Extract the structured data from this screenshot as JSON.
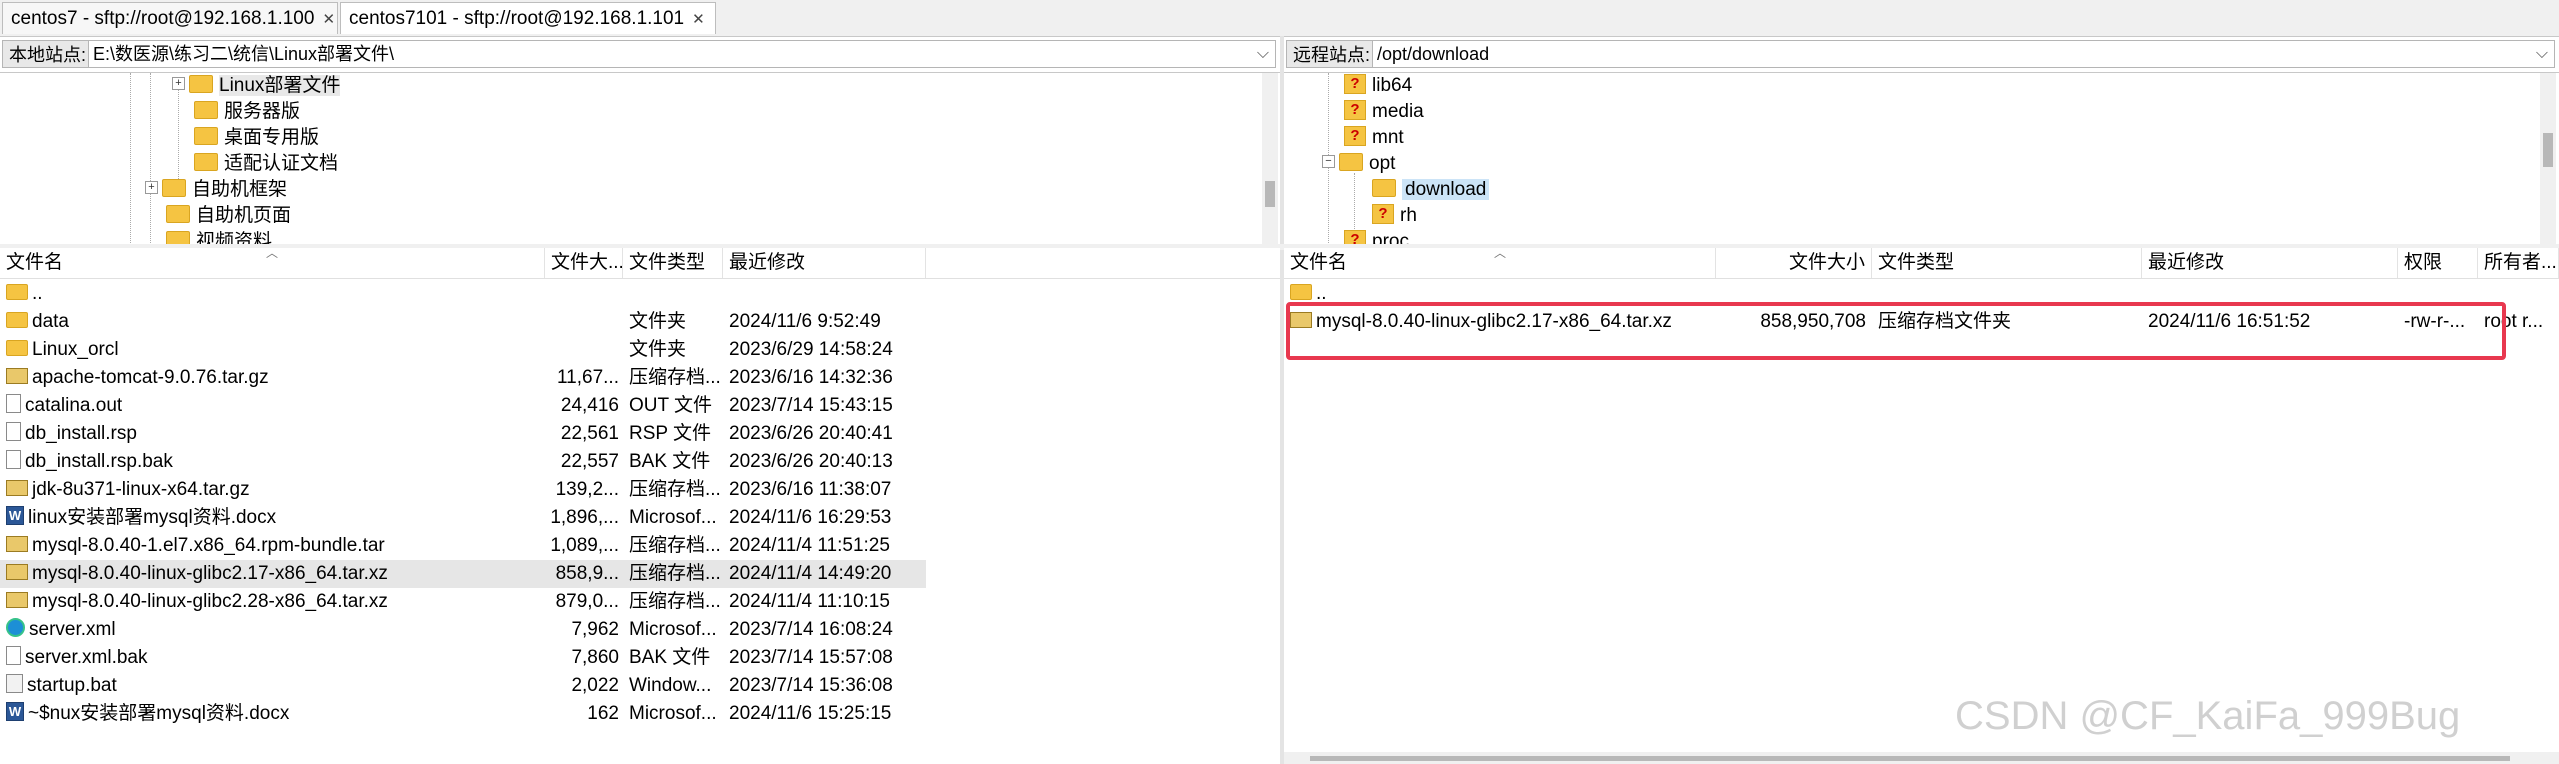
{
  "tabs": [
    {
      "label": "centos7 - sftp://root@192.168.1.100",
      "close": "✕"
    },
    {
      "label": "centos7101 - sftp://root@192.168.1.101",
      "close": "✕"
    }
  ],
  "local": {
    "site_label": "本地站点:",
    "site_path": "E:\\数医源\\练习二\\统信\\Linux部署文件\\",
    "tree": [
      {
        "label": "Linux部署文件",
        "expander": "+"
      },
      {
        "label": "服务器版"
      },
      {
        "label": "桌面专用版"
      },
      {
        "label": "适配认证文档"
      },
      {
        "label": "自助机框架",
        "expander": "+"
      },
      {
        "label": "自助机页面"
      },
      {
        "label": "视频资料"
      }
    ],
    "columns": {
      "name": "文件名",
      "size": "文件大...",
      "type": "文件类型",
      "modified": "最近修改"
    },
    "files": [
      {
        "icon": "folder-icon",
        "name": "..",
        "size": "",
        "type": "",
        "modified": ""
      },
      {
        "icon": "folder-icon",
        "name": "data",
        "size": "",
        "type": "文件夹",
        "modified": "2024/11/6 9:52:49"
      },
      {
        "icon": "folder-icon",
        "name": "Linux_orcl",
        "size": "",
        "type": "文件夹",
        "modified": "2023/6/29 14:58:24"
      },
      {
        "icon": "archive-icon",
        "name": "apache-tomcat-9.0.76.tar.gz",
        "size": "11,67...",
        "type": "压缩存档...",
        "modified": "2023/6/16 14:32:36"
      },
      {
        "icon": "file-icon",
        "name": "catalina.out",
        "size": "24,416",
        "type": "OUT 文件",
        "modified": "2023/7/14 15:43:15"
      },
      {
        "icon": "file-icon",
        "name": "db_install.rsp",
        "size": "22,561",
        "type": "RSP 文件",
        "modified": "2023/6/26 20:40:41"
      },
      {
        "icon": "file-icon",
        "name": "db_install.rsp.bak",
        "size": "22,557",
        "type": "BAK 文件",
        "modified": "2023/6/26 20:40:13"
      },
      {
        "icon": "archive-icon",
        "name": "jdk-8u371-linux-x64.tar.gz",
        "size": "139,2...",
        "type": "压缩存档...",
        "modified": "2023/6/16 11:38:07"
      },
      {
        "icon": "word-icon",
        "name": "linux安装部署mysql资料.docx",
        "size": "1,896,...",
        "type": "Microsof...",
        "modified": "2024/11/6 16:29:53"
      },
      {
        "icon": "archive-icon",
        "name": "mysql-8.0.40-1.el7.x86_64.rpm-bundle.tar",
        "size": "1,089,...",
        "type": "压缩存档...",
        "modified": "2024/11/4 11:51:25"
      },
      {
        "icon": "archive-icon",
        "name": "mysql-8.0.40-linux-glibc2.17-x86_64.tar.xz",
        "size": "858,9...",
        "type": "压缩存档...",
        "modified": "2024/11/4 14:49:20",
        "selected": true
      },
      {
        "icon": "archive-icon",
        "name": "mysql-8.0.40-linux-glibc2.28-x86_64.tar.xz",
        "size": "879,0...",
        "type": "压缩存档...",
        "modified": "2024/11/4 11:10:15"
      },
      {
        "icon": "edge-icon",
        "name": "server.xml",
        "size": "7,962",
        "type": "Microsof...",
        "modified": "2023/7/14 16:08:24"
      },
      {
        "icon": "file-icon",
        "name": "server.xml.bak",
        "size": "7,860",
        "type": "BAK 文件",
        "modified": "2023/7/14 15:57:08"
      },
      {
        "icon": "bat-icon",
        "name": "startup.bat",
        "size": "2,022",
        "type": "Window...",
        "modified": "2023/7/14 15:36:08"
      },
      {
        "icon": "word-icon",
        "name": "~$nux安装部署mysql资料.docx",
        "size": "162",
        "type": "Microsof...",
        "modified": "2024/11/6 15:25:15"
      }
    ]
  },
  "remote": {
    "site_label": "远程站点:",
    "site_path": "/opt/download",
    "tree": [
      {
        "label": "lib64",
        "icon": "question-folder-icon"
      },
      {
        "label": "media",
        "icon": "question-folder-icon"
      },
      {
        "label": "mnt",
        "icon": "question-folder-icon"
      },
      {
        "label": "opt",
        "icon": "folder-icon",
        "expander": "−"
      },
      {
        "label": "download",
        "icon": "folder-icon",
        "selected": true
      },
      {
        "label": "rh",
        "icon": "question-folder-icon"
      },
      {
        "label": "proc",
        "icon": "question-folder-icon"
      }
    ],
    "columns": {
      "name": "文件名",
      "size": "文件大小",
      "type": "文件类型",
      "modified": "最近修改",
      "perms": "权限",
      "owner": "所有者..."
    },
    "files": [
      {
        "icon": "folder-icon",
        "name": "..",
        "size": "",
        "type": "",
        "modified": "",
        "perms": "",
        "owner": ""
      },
      {
        "icon": "archive-icon",
        "name": "mysql-8.0.40-linux-glibc2.17-x86_64.tar.xz",
        "size": "858,950,708",
        "type": "压缩存档文件夹",
        "modified": "2024/11/6 16:51:52",
        "perms": "-rw-r-...",
        "owner": "root r..."
      }
    ]
  },
  "watermark": "CSDN @CF_KaiFa_999Bug",
  "colors": {
    "highlight_box": "#e8384f",
    "selection": "#cce4f7",
    "folder": "#f5c442"
  }
}
